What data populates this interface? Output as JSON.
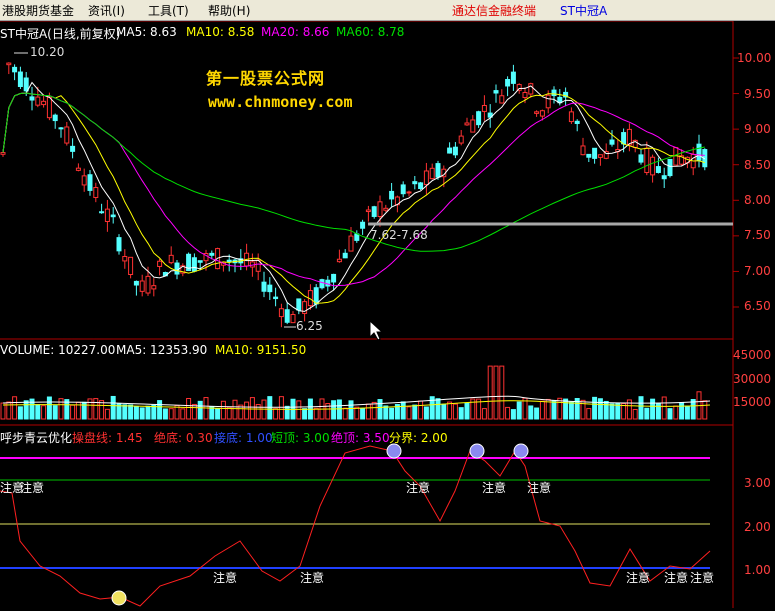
{
  "menu": {
    "items": [
      "港股期货基金",
      "资讯(I)",
      "工具(T)",
      "帮助(H)"
    ],
    "window_title": "通达信金融终端",
    "stock_link": "ST中冠A"
  },
  "price_panel": {
    "stock_label": "ST中冠A(日线,前复权)",
    "ma5": "MA5: 8.63",
    "ma10": "MA10: 8.58",
    "ma20": "MA20: 8.66",
    "ma60": "MA60: 8.78",
    "high_annotation": "10.20",
    "low_annotation": "6.25",
    "range_annotation": "7.62-7.68",
    "watermark_title": "第一股票公式网",
    "watermark_url": "www.chnmoney.com",
    "axis_ticks": [
      "10.00",
      "9.50",
      "9.00",
      "8.50",
      "8.00",
      "7.50",
      "7.00",
      "6.50"
    ]
  },
  "volume_panel": {
    "volume": "VOLUME: 10227.00",
    "ma5": "MA5: 12353.90",
    "ma10": "MA10: 9151.50",
    "axis_ticks": [
      "45000",
      "30000",
      "15000"
    ]
  },
  "indicator_panel": {
    "name": "呼步青云优化",
    "line1": "操盘线: 1.45",
    "line2": "绝底: 0.30",
    "line3": "接底: 1.00",
    "line4": "短顶: 3.00",
    "line5": "绝顶: 3.50",
    "line6": "分界: 2.00",
    "attention_label": "注意",
    "axis_ticks": [
      "3.00",
      "2.00",
      "1.00"
    ]
  },
  "colors": {
    "up": "#ff3232",
    "down": "#54ffff",
    "ma5": "#ffffff",
    "ma10": "#ffff00",
    "ma20": "#ff00ff",
    "ma60": "#00e000",
    "grid": "#b00000",
    "watermark": "#ffd700"
  }
}
